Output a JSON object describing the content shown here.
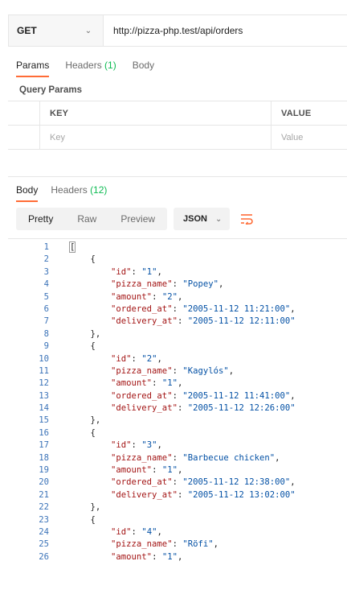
{
  "request": {
    "method": "GET",
    "url": "http://pizza-php.test/api/orders"
  },
  "request_tabs": {
    "params": "Params",
    "headers": "Headers",
    "headers_count": "(1)",
    "body": "Body"
  },
  "query_params": {
    "title": "Query Params",
    "key_header": "KEY",
    "value_header": "VALUE",
    "key_placeholder": "Key",
    "value_placeholder": "Value"
  },
  "response_tabs": {
    "body": "Body",
    "headers": "Headers",
    "headers_count": "(12)"
  },
  "response_toolbar": {
    "pretty": "Pretty",
    "raw": "Raw",
    "preview": "Preview",
    "format": "JSON"
  },
  "colors": {
    "accent": "#ff6c37",
    "green": "#0cbb52",
    "json_key": "#a31515",
    "json_string": "#0451a5",
    "line_number": "#3b73b8"
  },
  "orders": [
    {
      "id": "1",
      "pizza_name": "Popey",
      "amount": "2",
      "ordered_at": "2005-11-12 11:21:00",
      "delivery_at": "2005-11-12 12:11:00"
    },
    {
      "id": "2",
      "pizza_name": "Kagylós",
      "amount": "1",
      "ordered_at": "2005-11-12 11:41:00",
      "delivery_at": "2005-11-12 12:26:00"
    },
    {
      "id": "3",
      "pizza_name": "Barbecue chicken",
      "amount": "1",
      "ordered_at": "2005-11-12 12:38:00",
      "delivery_at": "2005-11-12 13:02:00"
    },
    {
      "id": "4",
      "pizza_name": "Röfi",
      "amount": "1"
    }
  ]
}
